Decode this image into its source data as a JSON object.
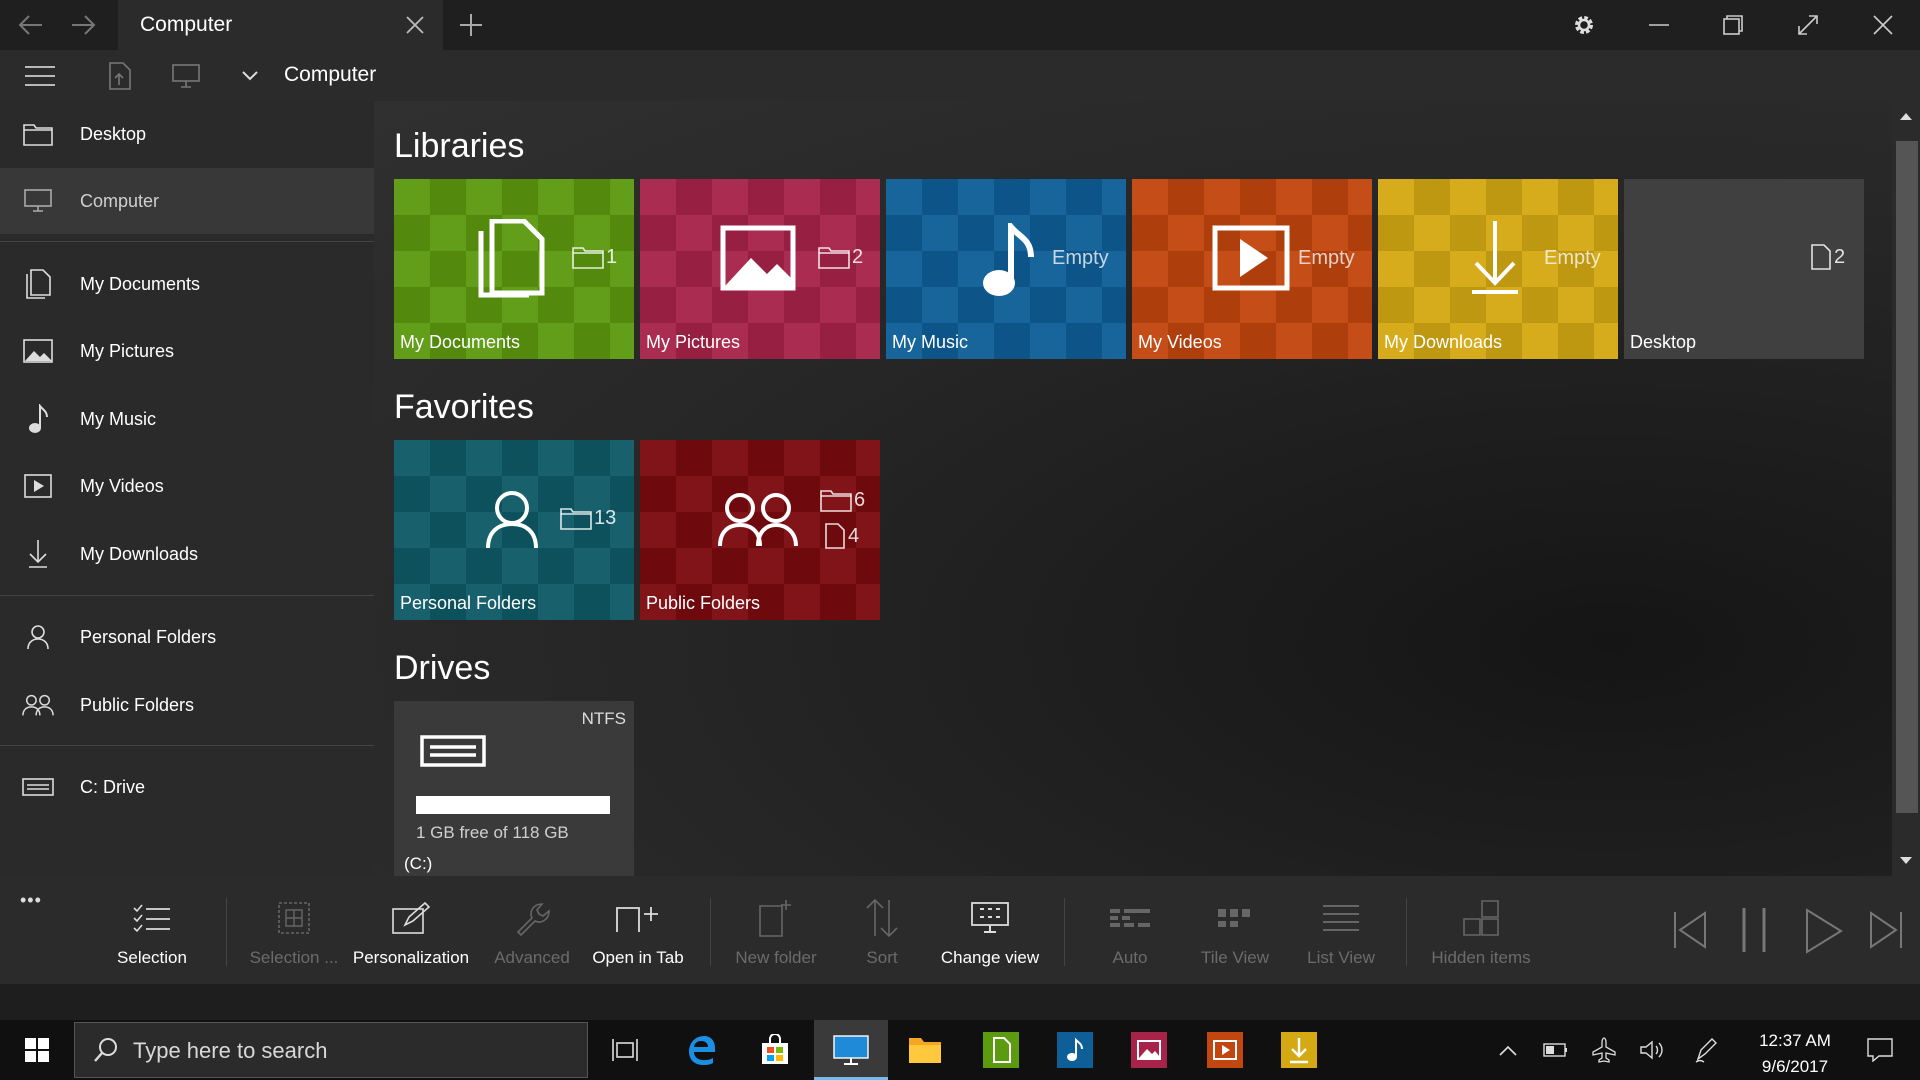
{
  "tab": {
    "title": "Computer"
  },
  "address": {
    "path": "Computer"
  },
  "sidebar": {
    "items": [
      {
        "label": "Desktop"
      },
      {
        "label": "Computer"
      },
      {
        "label": "My Documents"
      },
      {
        "label": "My Pictures"
      },
      {
        "label": "My Music"
      },
      {
        "label": "My Videos"
      },
      {
        "label": "My Downloads"
      },
      {
        "label": "Personal Folders"
      },
      {
        "label": "Public Folders"
      },
      {
        "label": "C: Drive"
      }
    ]
  },
  "main": {
    "libraries_title": "Libraries",
    "favorites_title": "Favorites",
    "drives_title": "Drives",
    "libraries": [
      {
        "label": "My Documents",
        "folders": "1",
        "color": "#5c9a10"
      },
      {
        "label": "My Pictures",
        "folders": "2",
        "color": "#a8234a"
      },
      {
        "label": "My Music",
        "status": "Empty",
        "color": "#0e5f97"
      },
      {
        "label": "My Videos",
        "status": "Empty",
        "color": "#c2460f"
      },
      {
        "label": "My Downloads",
        "status": "Empty",
        "color": "#d4a913"
      },
      {
        "label": "Desktop",
        "files": "2",
        "color": "#404040"
      }
    ],
    "favorites": [
      {
        "label": "Personal Folders",
        "folders": "13",
        "color": "#0f5a66"
      },
      {
        "label": "Public Folders",
        "folders": "6",
        "files": "4",
        "color": "#7b0a0f"
      }
    ],
    "drive": {
      "filesystem": "NTFS",
      "space": "1 GB free of 118 GB",
      "name": "(C:)",
      "used_fraction": 0.99
    }
  },
  "commandbar": {
    "more": "•••",
    "selection": "Selection",
    "selection_options": "Selection ...",
    "personalization": "Personalization",
    "advanced": "Advanced",
    "open_in_tab": "Open in Tab",
    "new_folder": "New folder",
    "sort": "Sort",
    "change_view": "Change view",
    "auto": "Auto",
    "tile_view": "Tile View",
    "list_view": "List View",
    "hidden_items": "Hidden items"
  },
  "taskbar": {
    "search_placeholder": "Type here to search",
    "time": "12:37 AM",
    "date": "9/6/2017"
  },
  "colors": {
    "accent": "#76b9ed",
    "sidebar_bg": "#2a2a2a",
    "titlebar_bg": "#1f1f1f"
  }
}
